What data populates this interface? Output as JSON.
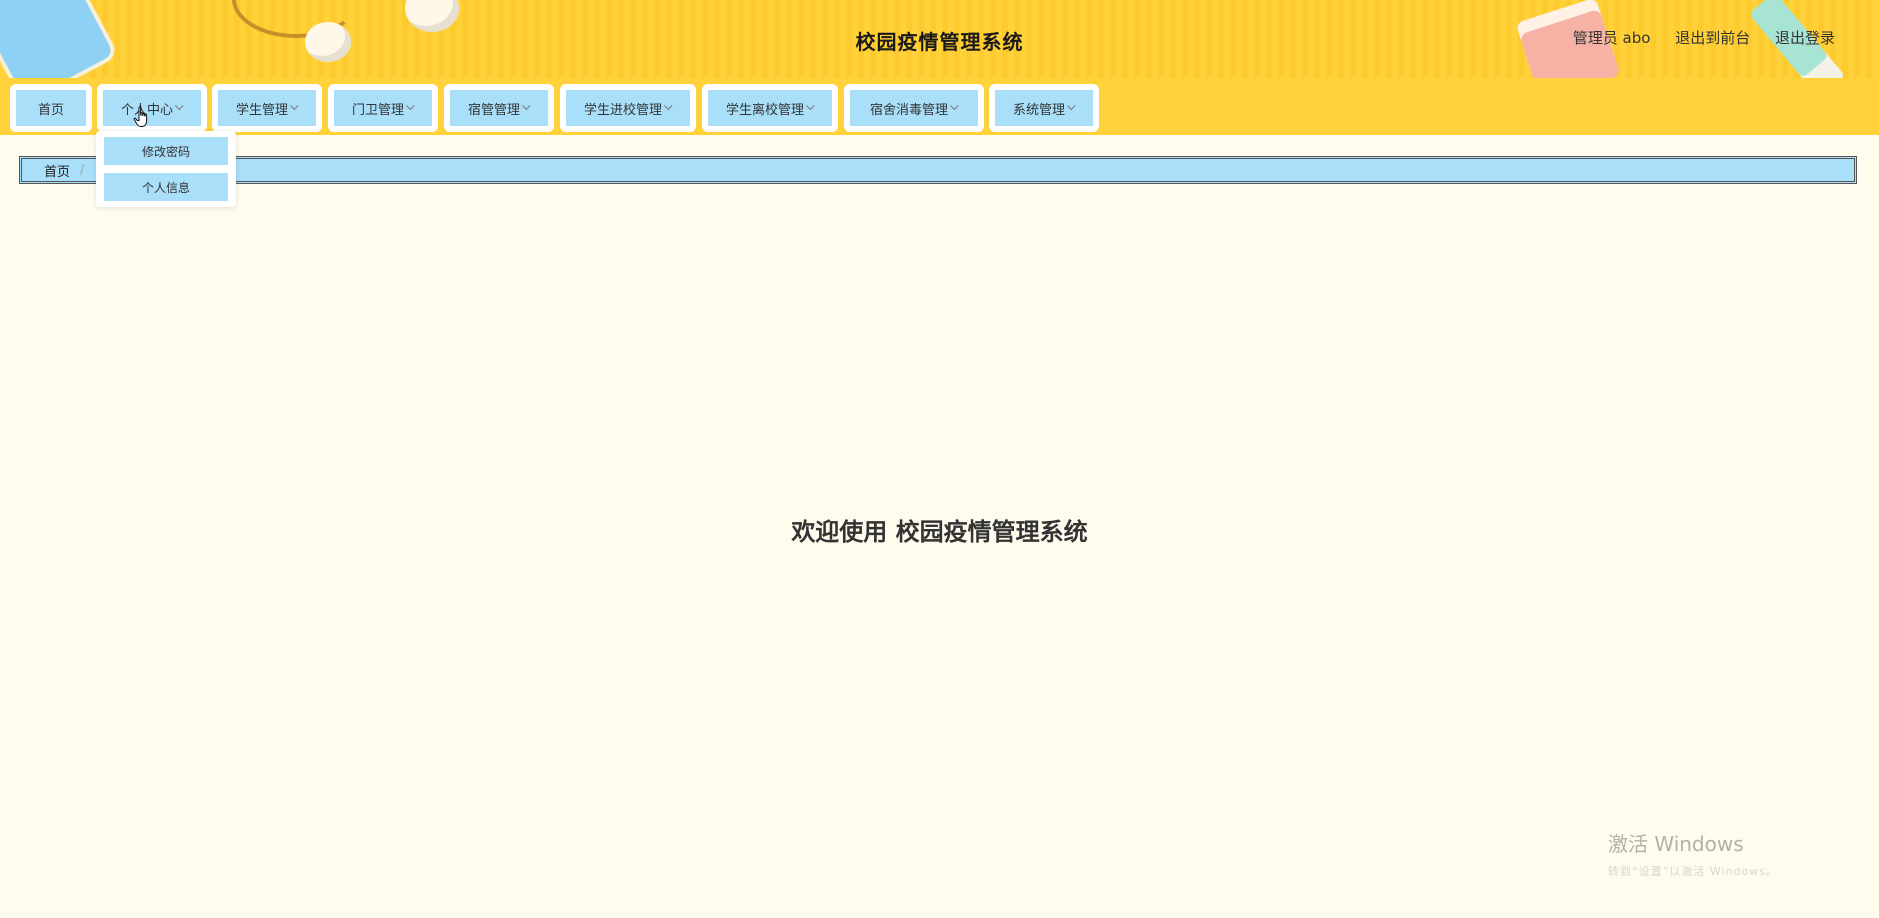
{
  "header": {
    "title": "校园疫情管理系统",
    "admin_label": "管理员 abo",
    "link_front": "退出到前台",
    "link_logout": "退出登录"
  },
  "nav": {
    "items": [
      {
        "label": "首页",
        "has_dropdown": false
      },
      {
        "label": "个人中心",
        "has_dropdown": true
      },
      {
        "label": "学生管理",
        "has_dropdown": true
      },
      {
        "label": "门卫管理",
        "has_dropdown": true
      },
      {
        "label": "宿管管理",
        "has_dropdown": true
      },
      {
        "label": "学生进校管理",
        "has_dropdown": true
      },
      {
        "label": "学生离校管理",
        "has_dropdown": true
      },
      {
        "label": "宿舍消毒管理",
        "has_dropdown": true
      },
      {
        "label": "系统管理",
        "has_dropdown": true
      }
    ],
    "dropdown": {
      "open_for": "个人中心",
      "items": [
        "修改密码",
        "个人信息"
      ]
    }
  },
  "breadcrumb": {
    "home": "首页",
    "separator": "/"
  },
  "main": {
    "welcome": "欢迎使用 校园疫情管理系统"
  },
  "watermark": {
    "title": "激活 Windows",
    "subtitle": "转到“设置”以激活 Windows。"
  },
  "colors": {
    "header_yellow": "#ffd13a",
    "menu_blue": "#a9dff9",
    "page_bg": "#fffcee"
  }
}
